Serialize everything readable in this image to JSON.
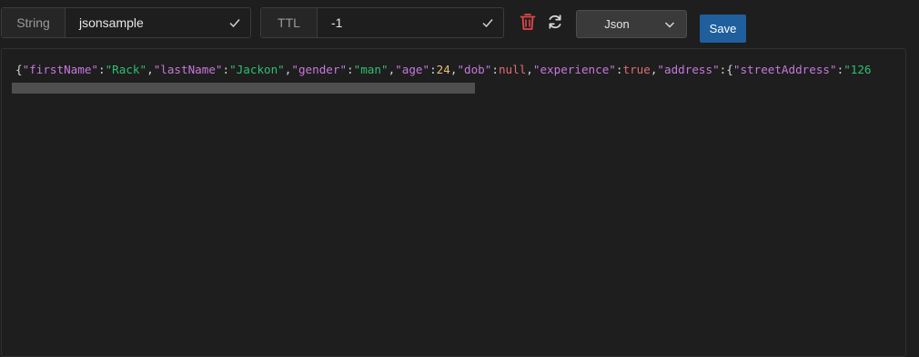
{
  "toolbar": {
    "key_type_label": "String",
    "key_name": "jsonsample",
    "ttl_label": "TTL",
    "ttl_value": "-1",
    "format_select": "Json",
    "save_label": "Save",
    "icons": {
      "confirm": "check-icon",
      "delete": "trash-icon",
      "refresh": "refresh-icon",
      "dropdown": "chevron-down-icon"
    }
  },
  "colors": {
    "key": "#c678dd",
    "string": "#2fbf71",
    "number": "#e5c07b",
    "literal": "#e06c75",
    "punct": "#d4d4d4",
    "delete_icon": "#e04848",
    "save_bg": "#1f5f9e"
  },
  "editor": {
    "tokens": [
      {
        "text": "{",
        "type": "punct"
      },
      {
        "text": "\"firstName\"",
        "type": "key"
      },
      {
        "text": ":",
        "type": "punct"
      },
      {
        "text": "\"Rack\"",
        "type": "string"
      },
      {
        "text": ",",
        "type": "punct"
      },
      {
        "text": "\"lastName\"",
        "type": "key"
      },
      {
        "text": ":",
        "type": "punct"
      },
      {
        "text": "\"Jackon\"",
        "type": "string"
      },
      {
        "text": ",",
        "type": "punct"
      },
      {
        "text": "\"gender\"",
        "type": "key"
      },
      {
        "text": ":",
        "type": "punct"
      },
      {
        "text": "\"man\"",
        "type": "string"
      },
      {
        "text": ",",
        "type": "punct"
      },
      {
        "text": "\"age\"",
        "type": "key"
      },
      {
        "text": ":",
        "type": "punct"
      },
      {
        "text": "24",
        "type": "number"
      },
      {
        "text": ",",
        "type": "punct"
      },
      {
        "text": "\"dob\"",
        "type": "key"
      },
      {
        "text": ":",
        "type": "punct"
      },
      {
        "text": "null",
        "type": "literal"
      },
      {
        "text": ",",
        "type": "punct"
      },
      {
        "text": "\"experience\"",
        "type": "key"
      },
      {
        "text": ":",
        "type": "punct"
      },
      {
        "text": "true",
        "type": "literal"
      },
      {
        "text": ",",
        "type": "punct"
      },
      {
        "text": "\"address\"",
        "type": "key"
      },
      {
        "text": ":",
        "type": "punct"
      },
      {
        "text": "{",
        "type": "punct"
      },
      {
        "text": "\"streetAddress\"",
        "type": "key"
      },
      {
        "text": ":",
        "type": "punct"
      },
      {
        "text": "\"126",
        "type": "string"
      }
    ]
  }
}
